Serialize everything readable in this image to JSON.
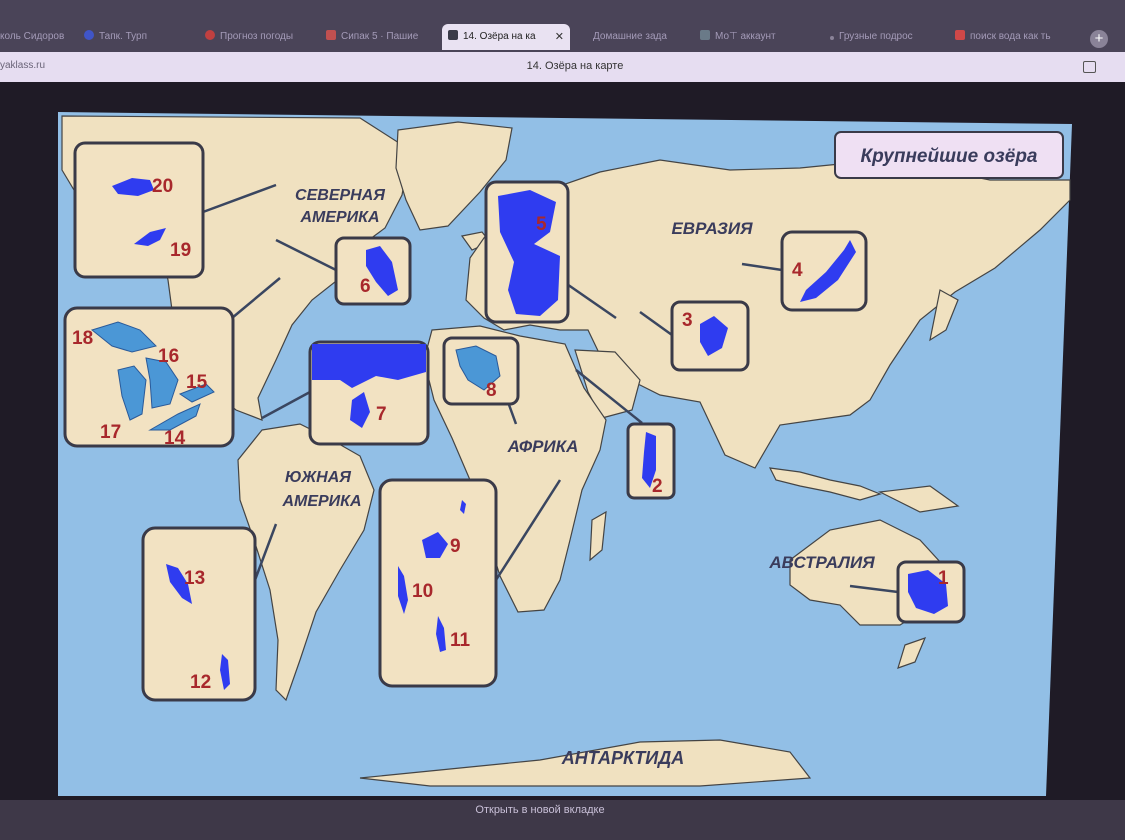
{
  "browser": {
    "tabs": [
      {
        "label": "коль Сидоров",
        "active": false
      },
      {
        "label": "Тапк. Турп",
        "active": false
      },
      {
        "label": "Прогноз погоды",
        "active": false
      },
      {
        "label": "Сипак 5 · Пашие",
        "active": false
      },
      {
        "label": "14. Озёра на ка",
        "active": true
      },
      {
        "label": "Домашние зада",
        "active": false
      },
      {
        "label": "Мо⊤ аккаунт",
        "active": false
      },
      {
        "label": "Грузные подрос",
        "active": false
      },
      {
        "label": "поиск вода как ть",
        "active": false
      }
    ],
    "close_glyph": "✕",
    "new_tab_glyph": "+",
    "url": "yaklass.ru",
    "page_title": "14. Озёра на карте",
    "open_in_new_tab": "Открыть в новой вкладке"
  },
  "map": {
    "title": "Крупнейшие озёра",
    "continents": {
      "north_america": "СЕВЕРНАЯ АМЕРИКА",
      "south_america": "ЮЖНАЯ АМЕРИКА",
      "eurasia": "ЕВРАЗИЯ",
      "africa": "АФРИКА",
      "australia": "АВСТРАЛИЯ",
      "antarctica": "АНТАРКТИДА"
    },
    "lake_numbers": [
      "1",
      "2",
      "3",
      "4",
      "5",
      "6",
      "7",
      "8",
      "9",
      "10",
      "11",
      "12",
      "13",
      "14",
      "15",
      "16",
      "17",
      "18",
      "19",
      "20"
    ],
    "colors": {
      "ocean": "#92bfe6",
      "land": "#f0e1c0",
      "lake": "#2f3cf0",
      "great_lakes": "#4b97d6",
      "number": "#a8282c",
      "title_box": "#efe0f3"
    }
  }
}
